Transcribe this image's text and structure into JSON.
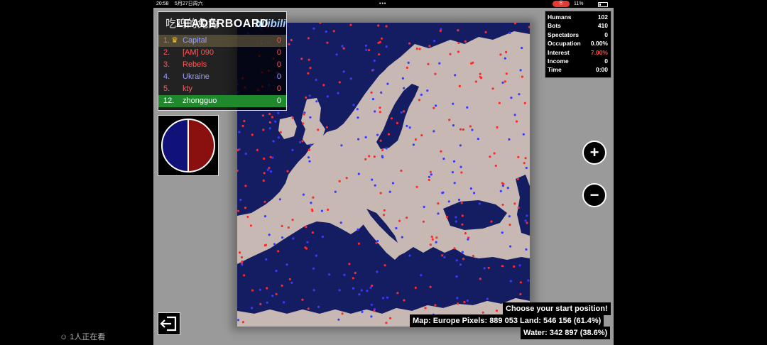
{
  "statusbar": {
    "time": "20:58",
    "date": "5月27日周六",
    "battery": "11%"
  },
  "watermark": {
    "text": "吃鸡的兔兔",
    "logo": "bilibili"
  },
  "leaderboard": {
    "title": "LEADERBOARD",
    "entries": [
      {
        "rank": "1.",
        "name": "Capital",
        "score": "0",
        "color": "#ff5a5a",
        "name_color": "#9aa0ff",
        "crown": true
      },
      {
        "rank": "2.",
        "name": "[AM] 090",
        "score": "0",
        "color": "#ff5a5a",
        "name_color": "#ff5a5a"
      },
      {
        "rank": "3.",
        "name": "Rebels",
        "score": "0",
        "color": "#ff5a5a",
        "name_color": "#ff5a5a"
      },
      {
        "rank": "4.",
        "name": "Ukraine",
        "score": "0",
        "color": "#9aa0ff",
        "name_color": "#9aa0ff"
      },
      {
        "rank": "5.",
        "name": "kty",
        "score": "0",
        "color": "#ff5a5a",
        "name_color": "#ff5a5a"
      },
      {
        "rank": "12.",
        "name": "zhongguo",
        "score": "0",
        "color": "#ffffff",
        "name_color": "#ffffff"
      }
    ]
  },
  "ratio": {
    "blue": 0.5,
    "red": 0.5,
    "blue_color": "#10127a",
    "red_color": "#8a1010"
  },
  "stats": [
    {
      "label": "Humans",
      "value": "102"
    },
    {
      "label": "Bots",
      "value": "410"
    },
    {
      "label": "Spectators",
      "value": "0"
    },
    {
      "label": "Occupation",
      "value": "0.00%"
    },
    {
      "label": "Interest",
      "value": "7.00%",
      "highlight": true
    },
    {
      "label": "Income",
      "value": "0"
    },
    {
      "label": "Time",
      "value": "0:00"
    }
  ],
  "zoom": {
    "in_label": "+",
    "out_label": "−"
  },
  "info": {
    "prompt": "Choose your start position!",
    "map_line": "Map: Europe   Pixels: 889 053   Land: 546 156 (61.4%)",
    "water_line": "Water: 342 897 (38.6%)"
  },
  "viewers": "1人正在看",
  "colors": {
    "water": "#151d62",
    "land": "#c8b8b4",
    "player_red": "#ff2a2a",
    "player_blue": "#3a3aff"
  }
}
